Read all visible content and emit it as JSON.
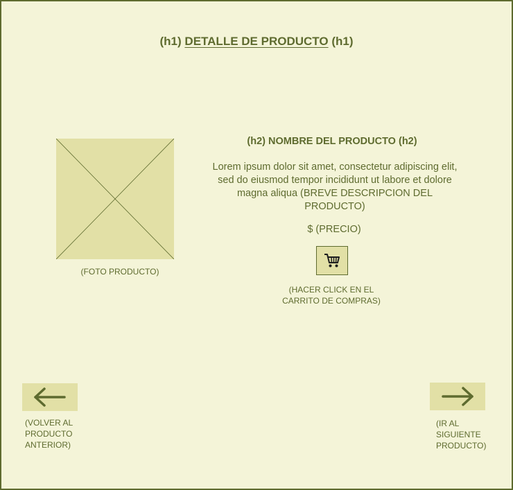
{
  "header": {
    "h1_prefix": "(h1)",
    "title": "DETALLE DE PRODUCTO",
    "h1_suffix": "(h1)"
  },
  "product": {
    "photo_caption": "(FOTO PRODUCTO)",
    "name_heading": "(h2) NOMBRE DEL PRODUCTO (h2)",
    "description": "Lorem ipsum dolor sit amet, consectetur adipiscing elit, sed do eiusmod tempor incididunt ut labore et dolore magna aliqua (BREVE DESCRIPCION DEL PRODUCTO)",
    "price": "$ (PRECIO)"
  },
  "cart": {
    "icon": "shopping-cart-icon",
    "caption": "(HACER CLICK EN EL CARRITO DE COMPRAS)"
  },
  "navigation": {
    "prev_icon": "arrow-left-icon",
    "prev_caption": "(VOLVER AL\nPRODUCTO\nANTERIOR)",
    "next_icon": "arrow-right-icon",
    "next_caption": "(IR AL\nSIGUIENTE\nPRODUCTO)"
  },
  "colors": {
    "background": "#f4f4d8",
    "accent": "#5e6b2f",
    "placeholder_fill": "#e2e0a6"
  }
}
